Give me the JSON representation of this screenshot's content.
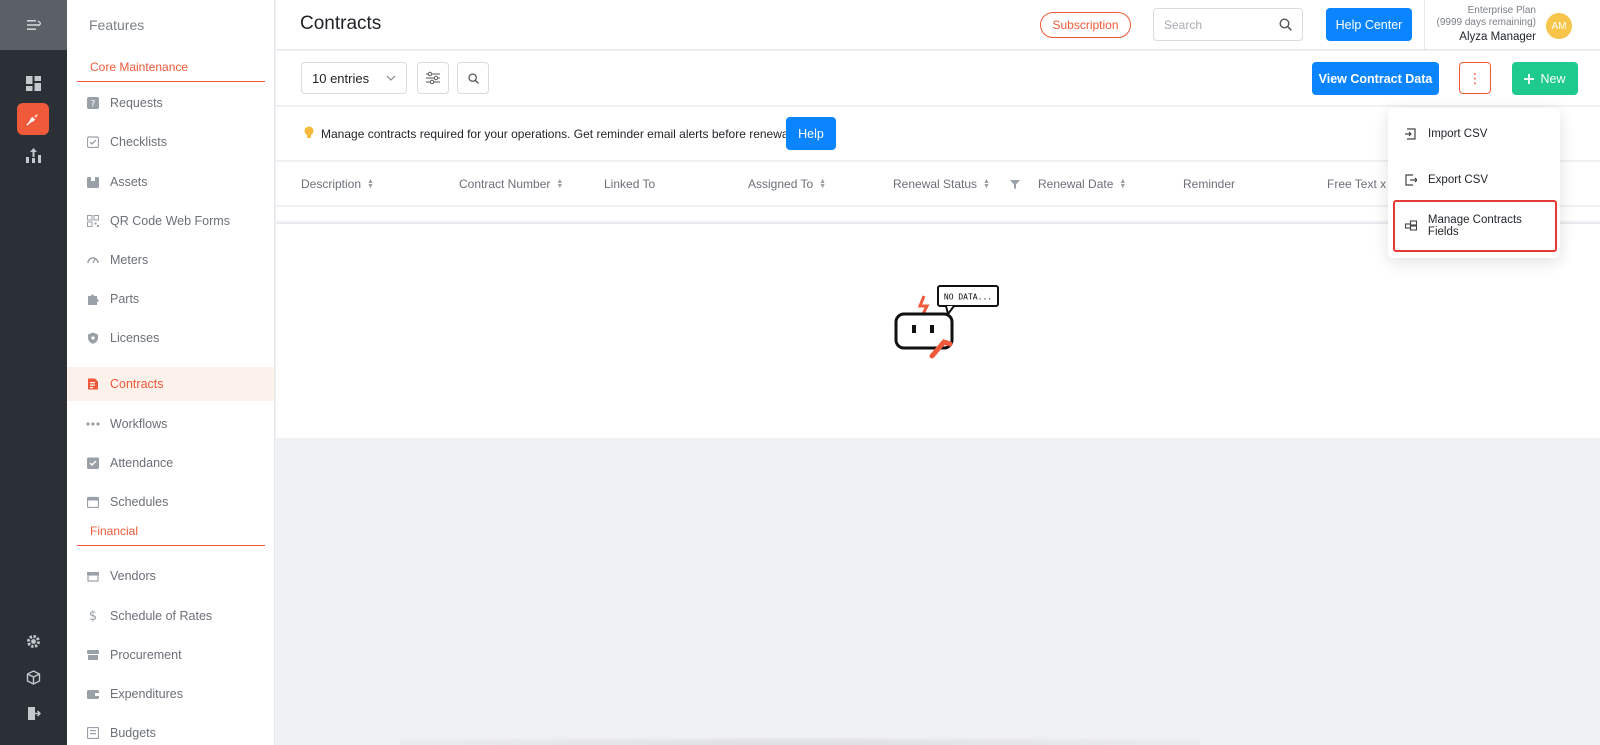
{
  "rail": {
    "items": [
      "menu-collapse-icon",
      "dashboard-icon",
      "features-icon",
      "reports-icon",
      "settings-icon",
      "package-icon",
      "logout-icon"
    ],
    "accent": "#f05a3a"
  },
  "sidebar": {
    "title": "Features",
    "sections": [
      {
        "label": "Core Maintenance",
        "items": [
          {
            "label": "Requests",
            "icon": "question-icon"
          },
          {
            "label": "Checklists",
            "icon": "checklist-icon"
          },
          {
            "label": "Assets",
            "icon": "asset-icon"
          },
          {
            "label": "QR Code Web Forms",
            "icon": "qr-code-icon"
          },
          {
            "label": "Meters",
            "icon": "gauge-icon"
          },
          {
            "label": "Parts",
            "icon": "puzzle-icon"
          },
          {
            "label": "Licenses",
            "icon": "shield-icon"
          },
          {
            "label": "Contracts",
            "icon": "contract-icon",
            "active": true
          },
          {
            "label": "Workflows",
            "icon": "workflow-icon"
          },
          {
            "label": "Attendance",
            "icon": "attendance-icon"
          },
          {
            "label": "Schedules",
            "icon": "calendar-icon"
          }
        ]
      },
      {
        "label": "Financial",
        "items": [
          {
            "label": "Vendors",
            "icon": "vendor-icon"
          },
          {
            "label": "Schedule of Rates",
            "icon": "dollar-icon"
          },
          {
            "label": "Procurement",
            "icon": "store-icon"
          },
          {
            "label": "Expenditures",
            "icon": "wallet-icon"
          },
          {
            "label": "Budgets",
            "icon": "budget-icon"
          }
        ]
      }
    ]
  },
  "header": {
    "title": "Contracts",
    "subscription_label": "Subscription",
    "search_placeholder": "Search",
    "help_center_label": "Help Center",
    "plan_name": "Enterprise Plan",
    "plan_remaining": "(9999 days remaining)",
    "user_name": "Alyza Manager",
    "avatar_initials": "AM"
  },
  "toolbar": {
    "entries_label": "10 entries",
    "view_data_label": "View Contract Data",
    "more_label": "⋮",
    "new_label": "New"
  },
  "banner": {
    "text": "Manage contracts required for your operations. Get reminder email alerts before renewal",
    "help_label": "Help"
  },
  "table": {
    "columns": [
      {
        "label": "Description",
        "sortable": true
      },
      {
        "label": "Contract Number",
        "sortable": true
      },
      {
        "label": "Linked To",
        "sortable": false
      },
      {
        "label": "Assigned To",
        "sortable": true
      },
      {
        "label": "Renewal Status",
        "sortable": true,
        "filter": true
      },
      {
        "label": "Renewal Date",
        "sortable": true
      },
      {
        "label": "Reminder",
        "sortable": false
      },
      {
        "label": "Free Text x",
        "sortable": false
      }
    ],
    "empty_text": "NO DATA..."
  },
  "menu": {
    "items": [
      {
        "label": "Import CSV",
        "icon": "import-icon"
      },
      {
        "label": "Export CSV",
        "icon": "export-icon"
      },
      {
        "label": "Manage Contracts Fields",
        "icon": "fields-icon",
        "highlighted": true
      }
    ]
  }
}
